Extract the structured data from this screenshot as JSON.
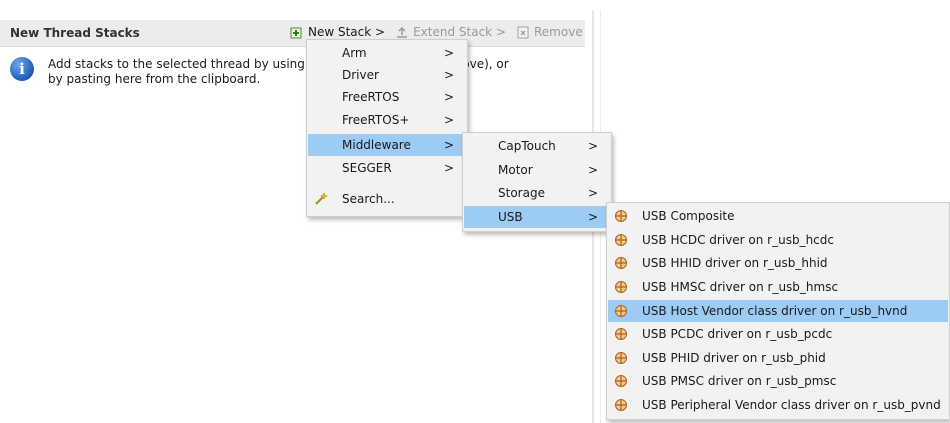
{
  "panel": {
    "title": "New Thread Stacks",
    "toolbar": {
      "new_stack": "New Stack >",
      "extend_stack": "Extend Stack >",
      "remove": "Remove"
    },
    "info_text": "Add stacks to the selected thread by using the New Stack button (above), or by pasting here from the clipboard."
  },
  "menu1": {
    "items": [
      {
        "label": "Arm",
        "arrow": ">"
      },
      {
        "label": "Driver",
        "arrow": ">"
      },
      {
        "label": "FreeRTOS",
        "arrow": ">"
      },
      {
        "label": "FreeRTOS+",
        "arrow": ">"
      },
      {
        "label": "Middleware",
        "arrow": ">"
      },
      {
        "label": "SEGGER",
        "arrow": ">"
      },
      {
        "label": "Search...",
        "arrow": ""
      }
    ]
  },
  "menu2": {
    "items": [
      {
        "label": "CapTouch",
        "arrow": ">"
      },
      {
        "label": "Motor",
        "arrow": ">"
      },
      {
        "label": "Storage",
        "arrow": ">"
      },
      {
        "label": "USB",
        "arrow": ">"
      }
    ]
  },
  "menu3": {
    "items": [
      {
        "label": "USB Composite"
      },
      {
        "label": "USB HCDC driver on r_usb_hcdc"
      },
      {
        "label": "USB HHID driver on r_usb_hhid"
      },
      {
        "label": "USB HMSC driver on r_usb_hmsc"
      },
      {
        "label": "USB Host Vendor class driver on r_usb_hvnd"
      },
      {
        "label": "USB PCDC driver on r_usb_pcdc"
      },
      {
        "label": "USB PHID driver on r_usb_phid"
      },
      {
        "label": "USB PMSC driver on r_usb_pmsc"
      },
      {
        "label": "USB Peripheral Vendor class driver on r_usb_pvnd"
      }
    ]
  },
  "colors": {
    "selection": "#9ccbf3",
    "menu_bg": "#f2f2f2"
  }
}
